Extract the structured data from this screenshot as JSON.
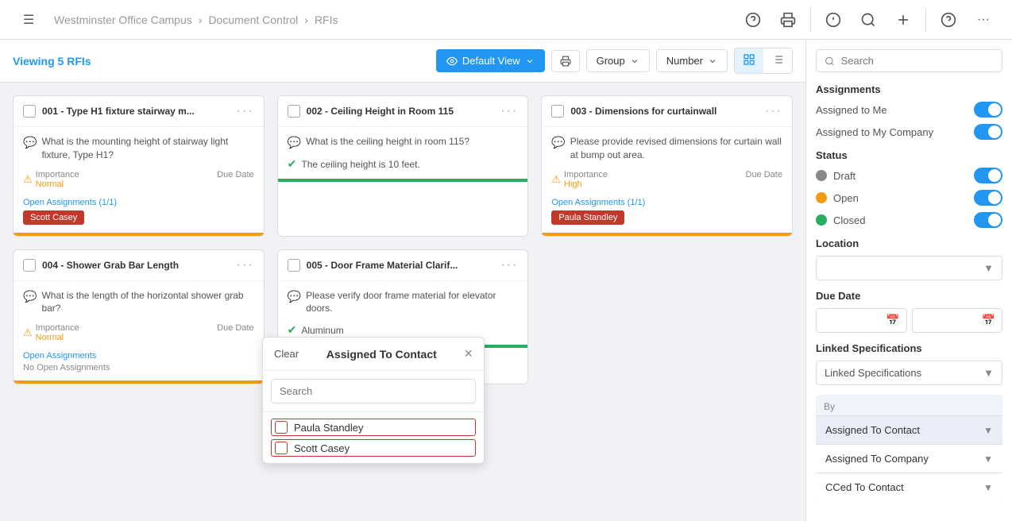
{
  "header": {
    "menu_icon": "☰",
    "breadcrumb": [
      "Westminster Office Campus",
      "Document Control",
      "RFIs"
    ],
    "breadcrumb_sep": "›",
    "icons": [
      "?",
      "🖨",
      "ℹ",
      "🔍",
      "+",
      "?",
      "···"
    ]
  },
  "toolbar": {
    "viewing_label": "Viewing 5 RFIs",
    "default_view_label": "Default View",
    "group_label": "Group",
    "number_label": "Number",
    "print_icon": "🖨"
  },
  "cards": [
    {
      "id": "001",
      "title": "001 - Type H1 fixture stairway m...",
      "description": "What is the mounting height of stairway light fixture, Type H1?",
      "has_importance": true,
      "importance": "Normal",
      "due_date": "Due Date",
      "assignments": "Open Assignments (1/1)",
      "assignee": "Scott Casey",
      "footer_color": "yellow"
    },
    {
      "id": "002",
      "title": "002 - Ceiling Height in Room 115",
      "description": "What is the ceiling height in room 115?",
      "answer": "The ceiling height is 10 feet.",
      "has_importance": false,
      "footer_color": "green"
    },
    {
      "id": "003",
      "title": "003 - Dimensions for curtainwall",
      "description": "Please provide revised dimensions for curtain wall at bump out area.",
      "has_importance": true,
      "importance": "High",
      "due_date": "Due Date",
      "assignments": "Open Assignments (1/1)",
      "assignee": "Paula Standley",
      "footer_color": "yellow"
    },
    {
      "id": "004",
      "title": "004 - Shower Grab Bar Length",
      "description": "What is the length of the horizontal shower grab bar?",
      "has_importance": true,
      "importance": "Normal",
      "due_date": "Due Date",
      "assignments": "Open Assignments",
      "no_assignments": "No Open Assignments",
      "footer_color": "yellow"
    },
    {
      "id": "005",
      "title": "005 - Door Frame Material Clarif...",
      "description": "Please verify door frame material for elevator doors.",
      "answer": "Aluminum",
      "has_importance": false,
      "footer_color": "green"
    }
  ],
  "sidebar": {
    "search_placeholder": "Search",
    "sections": {
      "assignments": {
        "title": "Assignments",
        "assigned_to_me_label": "Assigned to Me",
        "assigned_to_my_company_label": "Assigned to My Company",
        "me_toggle_on": true,
        "company_toggle_on": true
      },
      "status": {
        "title": "Status",
        "items": [
          {
            "label": "Draft",
            "color": "gray",
            "toggle_on": true
          },
          {
            "label": "Open",
            "color": "yellow",
            "toggle_on": true
          },
          {
            "label": "Closed",
            "color": "green",
            "toggle_on": true
          }
        ]
      },
      "location": {
        "title": "Location",
        "placeholder": ""
      },
      "due_date": {
        "title": "Due Date"
      },
      "linked_specs": {
        "title": "Linked Specifications",
        "select_label": "Linked Specifications"
      },
      "by": {
        "label": "By",
        "items": [
          {
            "label": "Assigned To Contact",
            "active": true
          },
          {
            "label": "Assigned To Company",
            "active": false
          },
          {
            "label": "CCed To Contact",
            "active": false
          }
        ]
      }
    }
  },
  "dropdown": {
    "title": "Assigned To Contact",
    "clear_label": "Clear",
    "close_icon": "×",
    "search_placeholder": "Search",
    "contacts": [
      {
        "name": "Paula Standley",
        "checked": false
      },
      {
        "name": "Scott Casey",
        "checked": false
      }
    ]
  }
}
